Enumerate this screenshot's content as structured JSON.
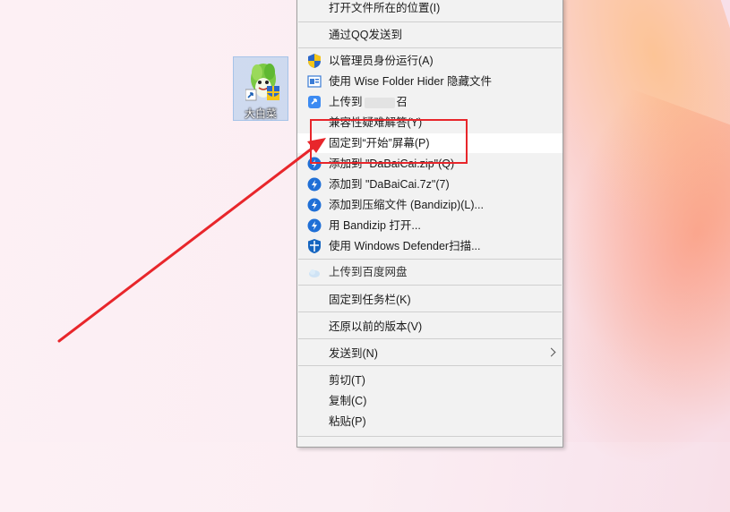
{
  "desktop": {
    "icon_label": "大白菜"
  },
  "menu": {
    "items": [
      {
        "label": "打开文件所在的位置(I)"
      },
      {
        "label": "通过QQ发送到"
      },
      {
        "label": "以管理员身份运行(A)",
        "icon": "uac-shield-icon"
      },
      {
        "label": "使用 Wise Folder Hider 隐藏文件",
        "icon": "wise-folder-hider-icon"
      },
      {
        "label_prefix": "上传到",
        "label_suffix": "召",
        "icon": "upload-cloud-icon"
      },
      {
        "label": "兼容性疑难解答(Y)"
      },
      {
        "label": "固定到“开始”屏幕(P)"
      },
      {
        "label": "添加到 \"DaBaiCai.zip\"(Q)",
        "icon": "bandizip-icon"
      },
      {
        "label": "添加到 \"DaBaiCai.7z\"(7)",
        "icon": "bandizip-icon"
      },
      {
        "label": "添加到压缩文件 (Bandizip)(L)...",
        "icon": "bandizip-icon"
      },
      {
        "label": "用 Bandizip 打开...",
        "icon": "bandizip-icon"
      },
      {
        "label": "使用 Windows Defender扫描...",
        "icon": "defender-icon"
      },
      {
        "label": "上传到百度网盘",
        "icon": "baidu-netdisk-icon"
      },
      {
        "label": "固定到任务栏(K)"
      },
      {
        "label": "还原以前的版本(V)"
      },
      {
        "label": "发送到(N)"
      },
      {
        "label": "剪切(T)"
      },
      {
        "label": "复制(C)"
      },
      {
        "label": "粘贴(P)"
      }
    ]
  },
  "colors": {
    "highlight_box": "#e8262b",
    "arrow": "#e8262b",
    "menu_bg": "#f2f2f2",
    "hover_bg": "#ffffff"
  }
}
